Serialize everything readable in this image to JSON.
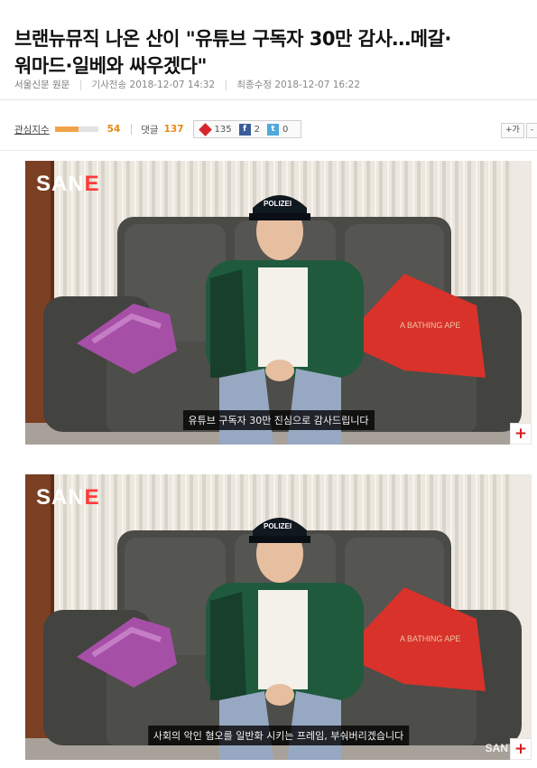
{
  "article": {
    "title_line1": "브랜뉴뮤직 나온 산이 \"유튜브 구독자 30만 감사…메갈·",
    "title_line2": "워마드·일베와 싸우겠다\"",
    "source": "서울신문 원문",
    "sent_label": "기사전송",
    "sent_time": "2018-12-07 14:32",
    "modified_label": "최종수정",
    "modified_time": "2018-12-07 16:22"
  },
  "stats": {
    "interest_label": "관심지수",
    "interest_value": "54",
    "interest_level": 0.54,
    "comment_label": "댓글",
    "comment_value": "137",
    "share_count": "135",
    "facebook_count": "2",
    "twitter_count": "0",
    "font_plus": "+가",
    "font_minus": "-"
  },
  "images": [
    {
      "logo": "SAN",
      "logo_accent": "E",
      "hat_text": "POLIZEI",
      "pillow_text": "A BATHING APE",
      "caption": "유튜브 구독자 30만 진심으로 감사드립니다",
      "zoom": "+"
    },
    {
      "logo": "SAN",
      "logo_accent": "E",
      "hat_text": "POLIZEI",
      "pillow_text": "A BATHING APE",
      "caption": "사회의 악인 혐오를 일반화 시키는 프레임, 부숴버리겠습니다",
      "watermark": "SAN",
      "zoom": "+"
    }
  ],
  "colors": {
    "accent_orange": "#e58a12",
    "zoom_red": "#d51d1d",
    "sofa": "#4f4f4c",
    "shirt_green": "#1f5a3c",
    "pillow_red": "#d8322a",
    "pillow_purple": "#a64fa7"
  }
}
